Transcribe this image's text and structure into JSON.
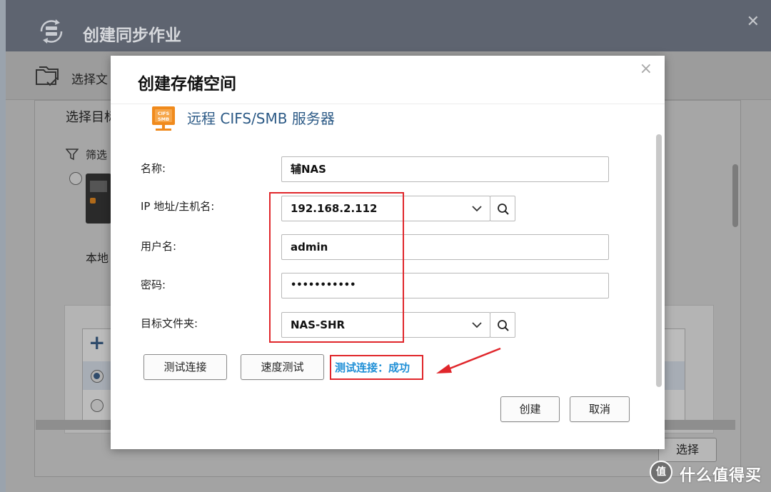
{
  "background_window": {
    "title": "创建同步作业",
    "toolbar_label": "选择文",
    "select_target_label": "选择目标",
    "filter_label": "筛选",
    "local_label": "本地",
    "select_button": "选择"
  },
  "modal": {
    "title": "创建存储空间",
    "close_glyph": "×",
    "server_type_label": "远程 CIFS/SMB 服务器",
    "fields": {
      "name_label": "名称:",
      "name_value": "辅NAS",
      "ip_label": "IP 地址/主机名:",
      "ip_value": "192.168.2.112",
      "username_label": "用户名:",
      "username_value": "admin",
      "password_label": "密码:",
      "password_value": "•••••••••••",
      "target_folder_label": "目标文件夹:",
      "target_folder_value": "NAS-SHR"
    },
    "buttons": {
      "test_connection": "测试连接",
      "speed_test": "速度测试",
      "create": "创建",
      "cancel": "取消"
    },
    "status": "测试连接：成功"
  },
  "watermark": {
    "logo_text": "值",
    "text": "什么值得买"
  },
  "colors": {
    "annotation_red": "#e0262b",
    "status_blue": "#1f8fd6",
    "server_label_blue": "#2c5a86",
    "cifs_icon_orange": "#f08a1c"
  }
}
